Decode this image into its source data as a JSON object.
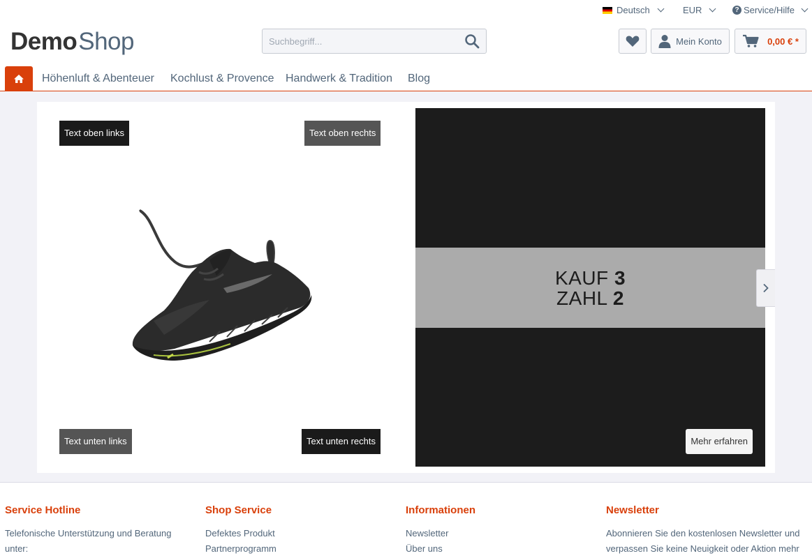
{
  "topbar": {
    "language": "Deutsch",
    "currency": "EUR",
    "service": "Service/Hilfe"
  },
  "logo": {
    "part1": "Demo",
    "part2": "Shop"
  },
  "search": {
    "placeholder": "Suchbegriff..."
  },
  "header": {
    "account_label": "Mein Konto",
    "cart_amount": "0,00 € *"
  },
  "nav": {
    "items": [
      "Höhenluft & Abenteuer",
      "Kochlust & Provence",
      "Handwerk & Tradition",
      "Blog"
    ]
  },
  "hero": {
    "label_top_left": "Text oben links",
    "label_top_right": "Text oben rechts",
    "label_bottom_left": "Text unten links",
    "label_bottom_right": "Text unten rechts",
    "promo_line1_word": "KAUF",
    "promo_line1_num": "3",
    "promo_line2_word": "ZAHL",
    "promo_line2_num": "2",
    "more_button": "Mehr erfahren"
  },
  "footer": {
    "hotline": {
      "title": "Service Hotline",
      "text": "Telefonische Unterstützung und Beratung unter:"
    },
    "shop_service": {
      "title": "Shop Service",
      "links": [
        "Defektes Produkt",
        "Partnerprogramm"
      ]
    },
    "info": {
      "title": "Informationen",
      "links": [
        "Newsletter",
        "Über uns"
      ]
    },
    "newsletter": {
      "title": "Newsletter",
      "text": "Abonnieren Sie den kostenlosen Newsletter und verpassen Sie keine Neuigkeit oder Aktion mehr"
    }
  },
  "colors": {
    "accent": "#d9400b",
    "text": "#52667a",
    "promo_dark": "#1c1c1c",
    "promo_band": "#ababab"
  }
}
